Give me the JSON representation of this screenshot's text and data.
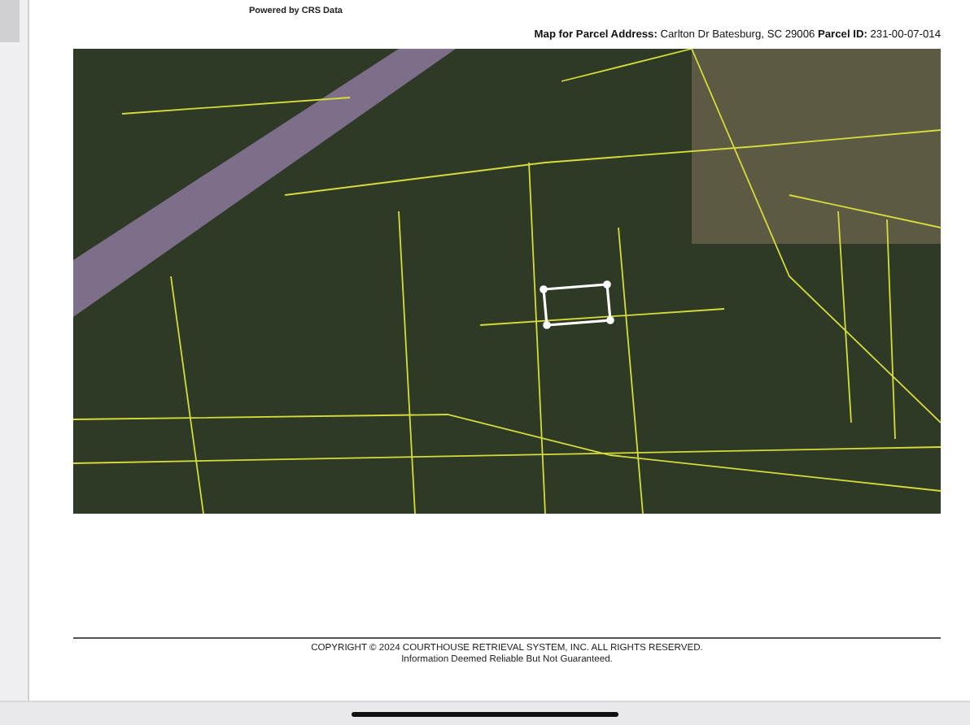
{
  "header": {
    "tagline": "Powered by CRS Data",
    "parcel_line": "**Map for Parcel Address:** Carlton Dr Batesburg, SC 29006 **Parcel ID:** 231-00-07-014"
  },
  "footer": {
    "copyright": "COPYRIGHT © 2024 COURTHOUSE RETRIEVAL SYSTEM, INC. ALL RIGHTS RESERVED.",
    "disclaimer": "Information Deemed Reliable But Not Guaranteed."
  }
}
